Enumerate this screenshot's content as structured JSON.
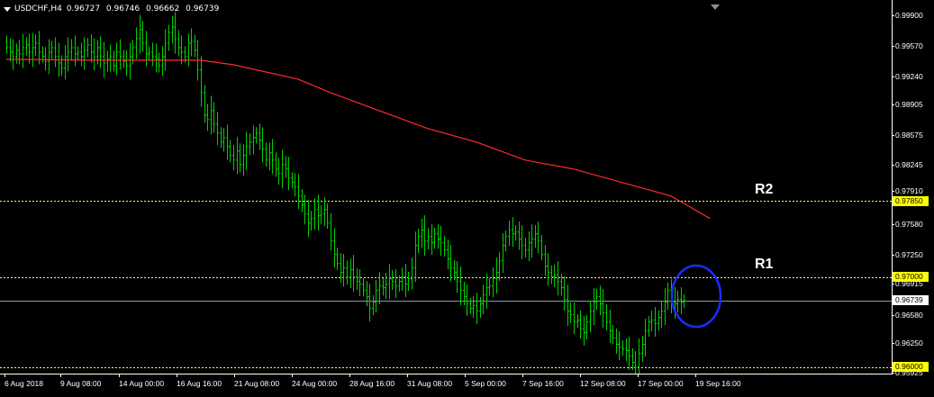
{
  "header": {
    "symbol": "USDCHF,H4",
    "open": "0.96727",
    "high": "0.96746",
    "low": "0.96662",
    "close": "0.96739"
  },
  "price_axis": {
    "ticks": [
      "0.99900",
      "0.99570",
      "0.99240",
      "0.98905",
      "0.98575",
      "0.98245",
      "0.97580",
      "0.97250",
      "0.96915",
      "0.96580",
      "0.96250",
      "0.95925"
    ],
    "partial_tick": "0.97910",
    "range": [
      0.95925,
      0.999
    ]
  },
  "time_axis": {
    "labels": [
      "6 Aug 2018",
      "9 Aug 08:00",
      "14 Aug 00:00",
      "16 Aug 16:00",
      "21 Aug 08:00",
      "24 Aug 00:00",
      "28 Aug 16:00",
      "31 Aug 08:00",
      "5 Sep 00:00",
      "7 Sep 16:00",
      "12 Sep 08:00",
      "17 Sep 00:00",
      "19 Sep 16:00"
    ]
  },
  "levels": [
    {
      "name": "R2",
      "price": 0.9785,
      "label": "0.97850"
    },
    {
      "name": "R1",
      "price": 0.97,
      "label": "0.97000"
    },
    {
      "name": "",
      "price": 0.96,
      "label": "0.96000"
    }
  ],
  "current_price": {
    "price": 0.96739,
    "label": "0.96739"
  },
  "colors": {
    "background": "#000000",
    "bars": "#00d000",
    "moving_average": "#ff2a2a",
    "levels": "#ffff66",
    "current_line": "#8a94aa",
    "circle": "#1a2cff",
    "label_highlight": "#ffff00"
  },
  "chart_data": {
    "type": "line",
    "symbol": "USDCHF",
    "timeframe": "H4",
    "series": [
      {
        "style": "ohlc-bars",
        "close": [
          0.9955,
          0.995,
          0.9945,
          0.9952,
          0.9948,
          0.9955,
          0.9958,
          0.995,
          0.9955,
          0.996,
          0.995,
          0.9945,
          0.994,
          0.995,
          0.9955,
          0.9945,
          0.9938,
          0.9932,
          0.9945,
          0.995,
          0.9955,
          0.9948,
          0.995,
          0.9945,
          0.9952,
          0.9958,
          0.995,
          0.9945,
          0.9955,
          0.9945,
          0.9938,
          0.9942,
          0.9945,
          0.9935,
          0.995,
          0.9945,
          0.994,
          0.9935,
          0.9945,
          0.9955,
          0.9965,
          0.9975,
          0.996,
          0.9948,
          0.995,
          0.9945,
          0.9942,
          0.9935,
          0.9945,
          0.996,
          0.9972,
          0.9978,
          0.9965,
          0.9955,
          0.995,
          0.9945,
          0.996,
          0.9962,
          0.9952,
          0.993,
          0.9905,
          0.988,
          0.9875,
          0.9885,
          0.987,
          0.986,
          0.985,
          0.9855,
          0.9845,
          0.9835,
          0.983,
          0.984,
          0.9825,
          0.9835,
          0.9845,
          0.985,
          0.9855,
          0.986,
          0.9852,
          0.9842,
          0.983,
          0.9838,
          0.983,
          0.982,
          0.9815,
          0.9825,
          0.982,
          0.981,
          0.9805,
          0.98,
          0.979,
          0.978,
          0.977,
          0.976,
          0.9765,
          0.9775,
          0.9768,
          0.977,
          0.9775,
          0.976,
          0.974,
          0.9725,
          0.9715,
          0.9705,
          0.971,
          0.97,
          0.9708,
          0.97,
          0.9695,
          0.9692,
          0.9685,
          0.9678,
          0.9665,
          0.9672,
          0.9685,
          0.969,
          0.9688,
          0.9692,
          0.9698,
          0.9695,
          0.969,
          0.9695,
          0.97,
          0.9692,
          0.9698,
          0.971,
          0.9735,
          0.9745,
          0.9752,
          0.974,
          0.9745,
          0.9738,
          0.9748,
          0.9742,
          0.9738,
          0.973,
          0.972,
          0.971,
          0.9705,
          0.9695,
          0.9685,
          0.9678,
          0.967,
          0.9665,
          0.9668,
          0.9662,
          0.967,
          0.968,
          0.9688,
          0.969,
          0.9698,
          0.9705,
          0.9718,
          0.9735,
          0.9745,
          0.9752,
          0.9748,
          0.975,
          0.9742,
          0.9735,
          0.973,
          0.9738,
          0.9742,
          0.9748,
          0.974,
          0.9725,
          0.9712,
          0.9705,
          0.97,
          0.9702,
          0.9695,
          0.9688,
          0.9675,
          0.9662,
          0.9658,
          0.965,
          0.9652,
          0.9642,
          0.9638,
          0.965,
          0.9662,
          0.9672,
          0.9678,
          0.967,
          0.966,
          0.965,
          0.964,
          0.9632,
          0.9625,
          0.9622,
          0.962,
          0.9618,
          0.9612,
          0.9605,
          0.96,
          0.9615,
          0.9625,
          0.964,
          0.965,
          0.9652,
          0.9648,
          0.9655,
          0.9662,
          0.9672,
          0.9685,
          0.9672,
          0.967,
          0.9675,
          0.9672,
          0.9674
        ]
      },
      {
        "style": "moving-average",
        "points": [
          [
            0,
            0.9942
          ],
          [
            30,
            0.9941
          ],
          [
            60,
            0.9941
          ],
          [
            70,
            0.9936
          ],
          [
            90,
            0.992
          ],
          [
            100,
            0.9905
          ],
          [
            115,
            0.9885
          ],
          [
            130,
            0.9865
          ],
          [
            145,
            0.985
          ],
          [
            160,
            0.983
          ],
          [
            175,
            0.982
          ],
          [
            190,
            0.9805
          ],
          [
            205,
            0.979
          ],
          [
            217,
            0.9765
          ]
        ]
      }
    ],
    "ylim": [
      0.95925,
      0.999
    ],
    "grid": false,
    "annotations": [
      "R2",
      "R1"
    ]
  }
}
